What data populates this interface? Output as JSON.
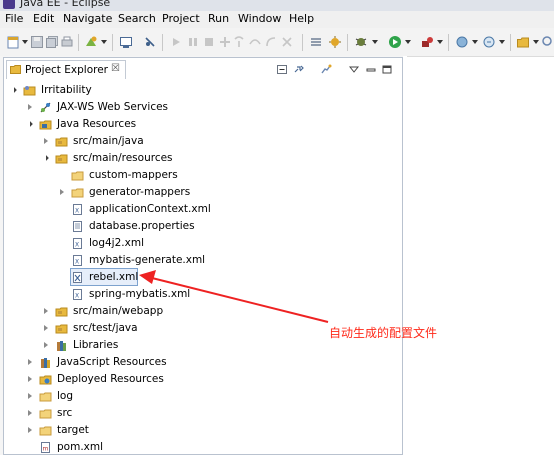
{
  "window": {
    "title": "Java EE - Eclipse"
  },
  "menu": [
    "File",
    "Edit",
    "Navigate",
    "Search",
    "Project",
    "Run",
    "Window",
    "Help"
  ],
  "view": {
    "tab_label": "Project Explorer",
    "tab_close": "☒"
  },
  "tree": {
    "project": "Irritability",
    "jaxws": "JAX-WS Web Services",
    "java_resources": "Java Resources",
    "src_main_java": "src/main/java",
    "src_main_resources": "src/main/resources",
    "custom_mappers": "custom-mappers",
    "generator_mappers": "generator-mappers",
    "application_context": "applicationContext.xml",
    "database_properties": "database.properties",
    "log4j2": "log4j2.xml",
    "mybatis_generate": "mybatis-generate.xml",
    "rebel": "rebel.xml",
    "spring_mybatis": "spring-mybatis.xml",
    "src_main_webapp": "src/main/webapp",
    "src_test_java": "src/test/java",
    "libraries": "Libraries",
    "js_resources": "JavaScript Resources",
    "deployed_resources": "Deployed Resources",
    "log": "log",
    "src": "src",
    "target": "target",
    "pom": "pom.xml"
  },
  "annotation": {
    "text": "自动生成的配置文件",
    "color": "#ff2a1a"
  },
  "colors": {
    "selection": "#e6eefa",
    "folder": "#e8b93e",
    "package_root": "#c89b3c",
    "arrow": "#ee2222"
  }
}
